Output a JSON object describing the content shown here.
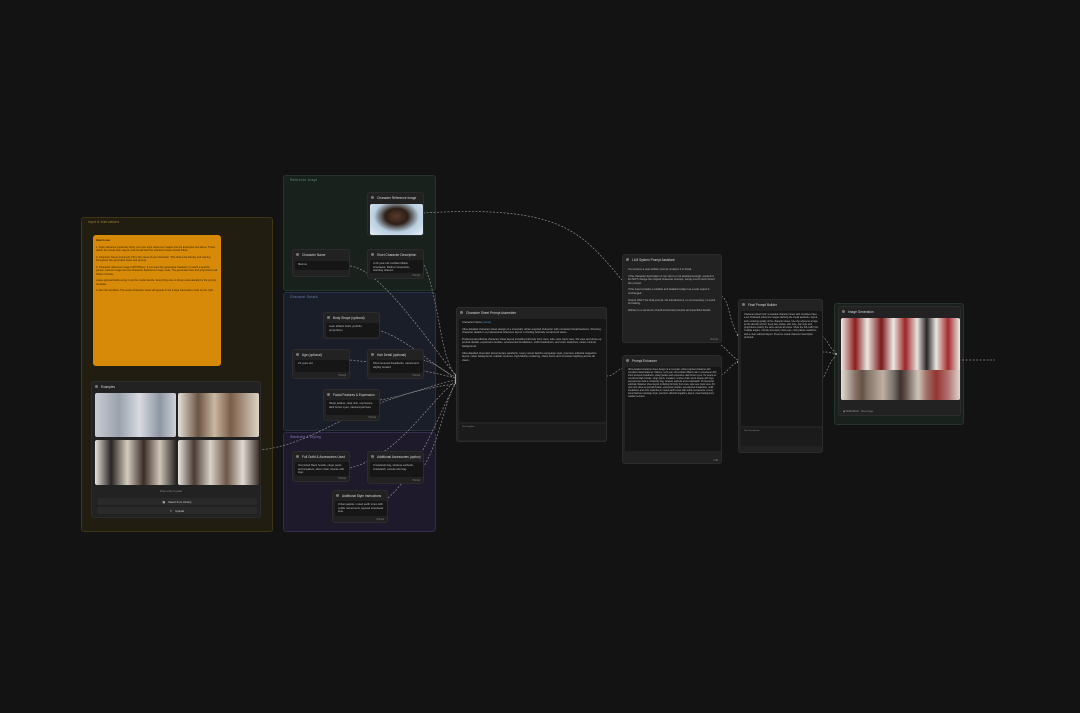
{
  "colors": {
    "background": "#131313",
    "node": "#222222",
    "note": "#d68a08",
    "wire": "#9a9a9a",
    "group_yellow": "#3a2f10",
    "group_green": "#1d2a24",
    "group_blue": "#1e2330",
    "group_purple": "#241f33",
    "link": "#4a8fd6"
  },
  "groups": {
    "inputs": "Input & Instructions",
    "reference": "Reference Image",
    "character": "Character Details",
    "wardrobe": "Wardrobe & Styling",
    "output": "Output"
  },
  "note": {
    "title": "How to use",
    "paragraphs": [
      "1. Style reference (optional): Drop your own style reference images into the Examples slot below. These define the visual style, layout, and overall look the character sheet should follow.",
      "2. Character Name (required): Fill in the name of your character. This drives the identity and naming throughout the generated sheet and prompt.",
      "3. Character reference image (OPTIONAL): If you want the generated character to match a specific person, load an image into the Character Reference Image node. The generated face and proportions will follow it closely.",
      "Leave optional fields empty to let the model decide. Everything else is driven automatically by the prompt template.",
      "4. Run the workflow. The output character sheet will appear in the Image Generation node on the right."
    ]
  },
  "examples": {
    "title": "Examples",
    "drop_hint": "Drop a file or paste",
    "library_button": "Select from Library",
    "upload_button": "Upload"
  },
  "reference_node": {
    "title": "Character Reference Image"
  },
  "name_node": {
    "title": "Character Name",
    "value": "Marcus"
  },
  "short_desc_node": {
    "title": "Short Character Description",
    "value": "A 24-year-old confident Black streetwear. Distinct visual look, standing relaxed.",
    "footer": "Prompt"
  },
  "body_node": {
    "title": "Body Shape (optional)",
    "value": "Lean athletic build, youthful proportions."
  },
  "age_node": {
    "title": "Age (optional)",
    "value": "24 years old",
    "footer": "Prompt"
  },
  "hair_node": {
    "title": "Hair Detail (optional)",
    "value": "Short textured dreadlocks, natural and slightly tousled.",
    "footer": "Prompt"
  },
  "facial_node": {
    "title": "Facial Features & Expression",
    "value": "Sharp jawline, clear skin, expressive dark brown eyes, natural eyebrows.",
    "footer": "Prompt"
  },
  "outfit_node": {
    "title": "Full Outfit & Accessories Used",
    "value": "Oversized black hoodie, cargo pants and sneakers, silver chain, beanie with logo.",
    "footer": "Prompt"
  },
  "acc_node": {
    "title": "Additional Accessories (option)",
    "value": "Crossbody bag, wireless earbuds, wristwatch, canvas tote bag.",
    "footer": "Prompt"
  },
  "style_node": {
    "title": "Additional Style Instructions",
    "value": "Urban palette, muted earth tones with subtle red accents, layered streetwear look.",
    "footer": "Prompt"
  },
  "template_node": {
    "title": "Character Sheet Prompt Assembler",
    "label": "Character Name",
    "para1": "Ultra-detailed character sheet design of a cinematic urban-inspired character with consistent facial features. Showing character details in a professional reference layout. Including full-body turnaround views.",
    "para2": "Professional editorial character sheet layout including full body front view, side view, back view, 3/4 view and close-up portrait details, expression studies, accessories breakdown, outfit breakdown, and color swatches, clean minimal background.",
    "para3": "Ultra-detailed cinematic documentary aesthetic, luxury street fashion campaign style, premium editorial magazine layout, clean background, realistic textures, high-fidelity rendering, sharp focus and consistent lighting across all views.",
    "footer": "Text Template"
  },
  "llm_node": {
    "title": "LLM System Prompt Assistant",
    "lines": [
      "You receive a user-written prompt. Analyze it in detail.",
      "If the character description is too short or not detailed enough, expand it. Do NOT change the original character concept, simply enrich and correct the prompt.",
      "If the input contains a reliable and detailed subject as a sole output it unchanged.",
      "Output ONLY the final prompt. No introductions, no commentary, no extra formatting.",
      "Refrain to a sentence of well-structured prompts and specified details."
    ],
    "footer": "Prompt"
  },
  "prompt_node": {
    "title": "Prompt Enhancer",
    "value": "Ultra-detailed character sheet design of a cinematic urban-inspired character with consistent facial features. Marcus, a 24 year old confident Black man in streetwear with short textured dreadlocks, sharp jawline and expressive dark brown eyes. He wears an oversized black hoodie, cargo pants, sneakers, a silver chain and a beanie with logo, accessorized with a crossbody bag, wireless earbuds and a wristwatch. Professional editorial character sheet layout including full body front view, side view, back view, 3/4 view and close-up portrait details, expression studies, accessories breakdown, outfit breakdown and color swatches in muted earth tones with subtle red accents. Luxury street fashion campaign style, premium editorial magazine layout, clean background, realistic textures.",
    "footer": "LLM"
  },
  "final_node": {
    "title": "Final Prompt Builder",
    "value": "Character sheet brief: a detailed character sheet with consistent face, a set of labeled reference images defining the visual aesthetic, layout, and rendering quality of the character sheet. Use the reference image as the identity anchor: keep face shape, skin tone, hair style and proportions exactly the same across all views. Show the full outfit from multiple angles. Include accessory close-ups, color palette swatches and a clean editorial layout. Preserve visual character description provided.",
    "footer": "Text Concatenate"
  },
  "output_node": {
    "title": "Image Generation",
    "badge": "SEEDREAM",
    "footer": "Save Image"
  }
}
